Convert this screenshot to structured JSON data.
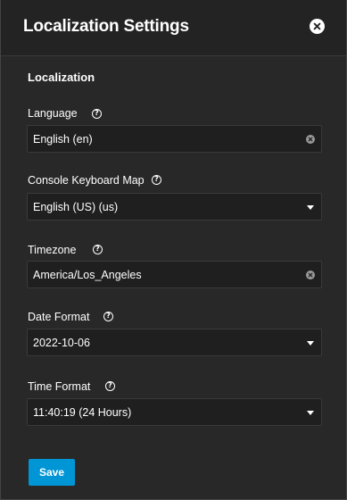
{
  "dialog": {
    "title": "Localization Settings",
    "section_title": "Localization"
  },
  "fields": {
    "language": {
      "label": "Language",
      "value": "English (en)",
      "control": "combobox-clearable"
    },
    "keyboard_map": {
      "label": "Console Keyboard Map",
      "value": "English (US) (us)",
      "control": "select"
    },
    "timezone": {
      "label": "Timezone",
      "value": "America/Los_Angeles",
      "control": "combobox-clearable"
    },
    "date_format": {
      "label": "Date Format",
      "value": "2022-10-06",
      "control": "select"
    },
    "time_format": {
      "label": "Time Format",
      "value": "11:40:19 (24 Hours)",
      "control": "select"
    }
  },
  "actions": {
    "save_label": "Save"
  },
  "icons": {
    "close": "close-circle-icon",
    "help": "help-circle-icon",
    "clear": "clear-circle-icon",
    "dropdown": "caret-down-icon"
  },
  "colors": {
    "panel_background": "#282828",
    "header_background": "#232323",
    "input_background": "#1f1f1f",
    "text": "#ffffff",
    "primary_button": "#0095d5"
  }
}
